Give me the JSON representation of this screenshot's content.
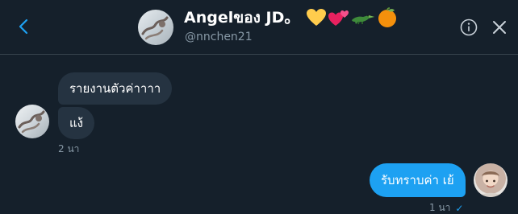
{
  "header": {
    "name": "Angelของ JD。",
    "handle": "@nnchen21",
    "emojis": [
      "yellow-heart-icon",
      "two-hearts-icon",
      "crocodile-icon",
      "tangerine-icon"
    ],
    "icons": {
      "back": "chevron-left-icon",
      "info": "info-icon",
      "close": "close-icon"
    }
  },
  "conversation": {
    "incoming": [
      {
        "text": "รายงานตัวค่าาาา"
      },
      {
        "text": "แง้"
      }
    ],
    "incoming_time": "2 นา",
    "outgoing": [
      {
        "text": "รับทราบค่า เย้"
      }
    ],
    "outgoing_time": "1 นา",
    "read_mark": "✓"
  },
  "colors": {
    "background": "#15202b",
    "bubble_in": "#253341",
    "bubble_out": "#1da1f2",
    "muted": "#8899a6"
  }
}
